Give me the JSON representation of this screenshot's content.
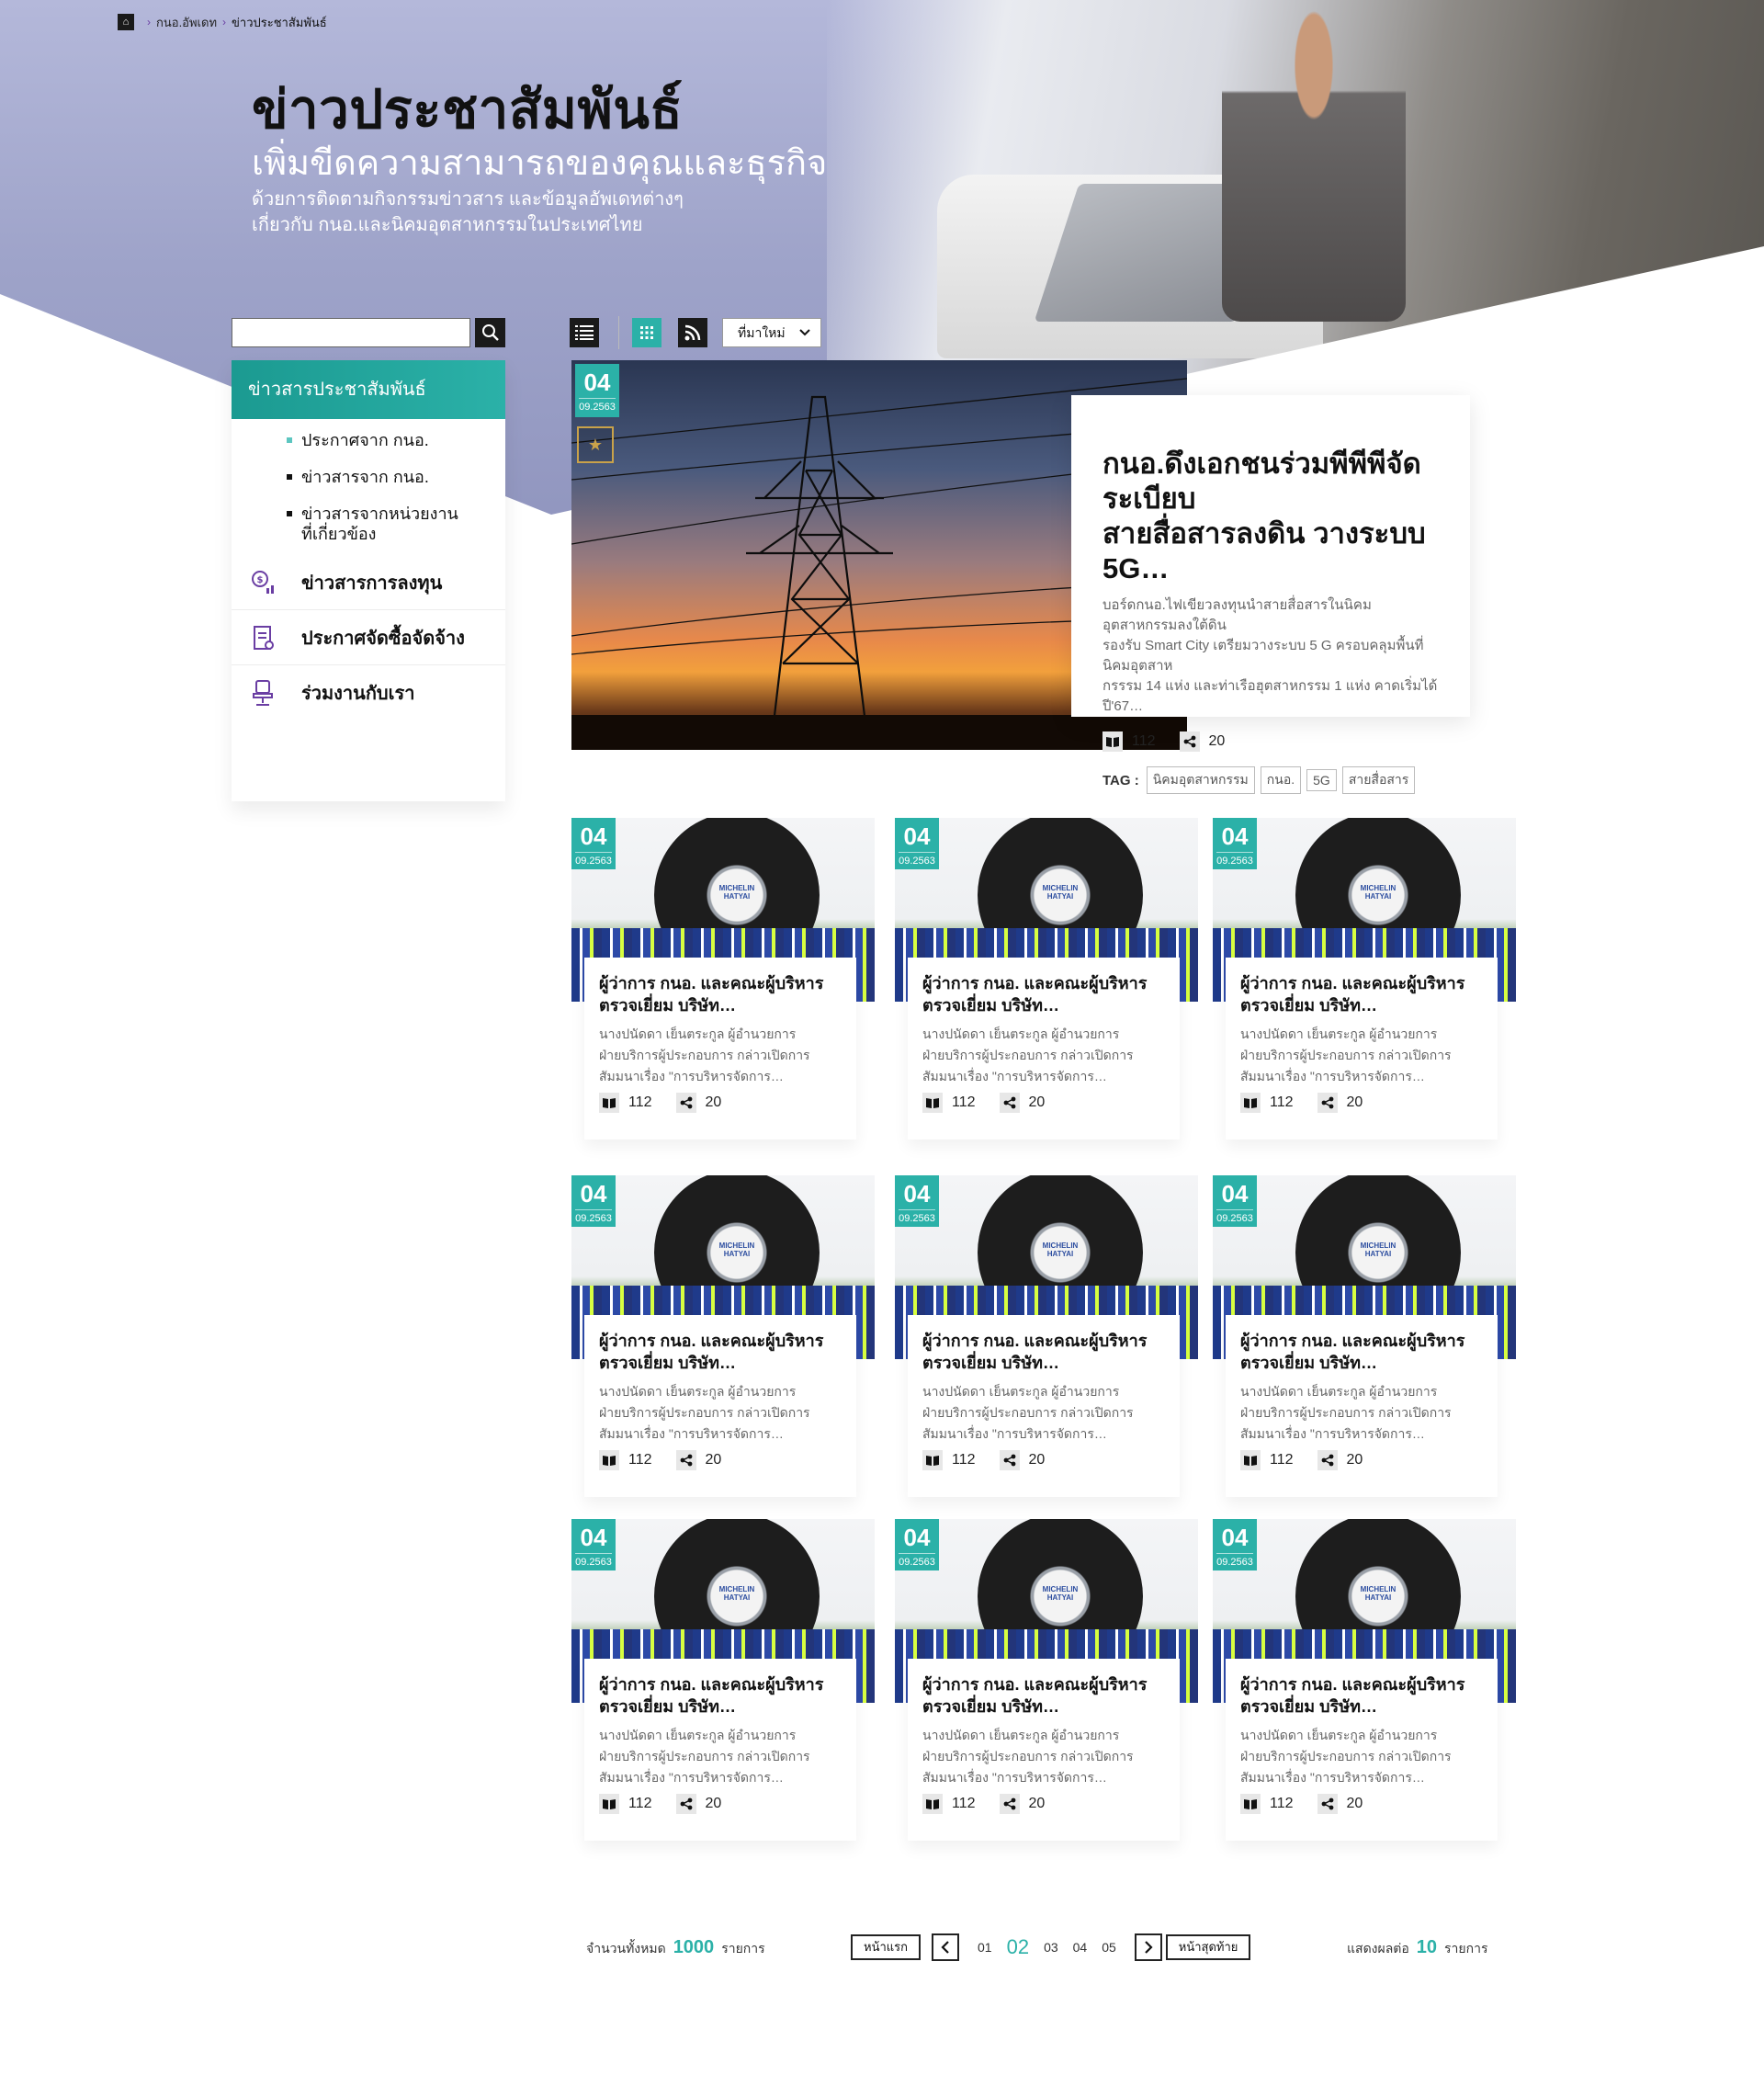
{
  "breadcrumb": {
    "home_icon": "home-icon",
    "items": [
      "กนอ.อัพเดท",
      "ข่าวประชาสัมพันธ์"
    ]
  },
  "hero": {
    "title": "ข่าวประชาสัมพันธ์",
    "subtitle": "เพิ่มขีดความสามารถของคุณและธุรกิจ",
    "desc_line1": "ด้วยการติดตามกิจกรรมข่าวสาร และข้อมูลอัพเดทต่างๆ",
    "desc_line2": "เกี่ยวกับ กนอ.และนิคมอุตสาหกรรมในประเทศไทย"
  },
  "search": {
    "value": "",
    "placeholder": ""
  },
  "sidebar": {
    "header": "ข่าวสารประชาสัมพันธ์",
    "sub_items": [
      {
        "label": "ประกาศจาก กนอ.",
        "active": true
      },
      {
        "label": "ข่าวสารจาก กนอ.",
        "active": false
      },
      {
        "label": "ข่าวสารจากหน่วยงาน",
        "label2": "ที่เกี่ยวข้อง",
        "active": false
      }
    ],
    "main_items": [
      {
        "label": "ข่าวสารการลงทุน",
        "icon": "investment-icon"
      },
      {
        "label": "ประกาศจัดซื้อจัดจ้าง",
        "icon": "procurement-icon"
      },
      {
        "label": "ร่วมงานกับเรา",
        "icon": "office-chair-icon"
      }
    ]
  },
  "toolbar": {
    "sort_value": "ที่มาใหม่",
    "active_view": "grid"
  },
  "featured": {
    "day": "04",
    "month": "09.2563",
    "title_line1": "กนอ.ดึงเอกชนร่วมพีพีพีจัดระเบียบ",
    "title_line2": "สายสื่อสารลงดิน วางระบบ 5G…",
    "excerpt_line1": "บอร์ดกนอ.ไฟเขียวลงทุนนำสายสื่อสารในนิคมอุตสาหกรรมลงใต้ดิน",
    "excerpt_line2": "รองรับ Smart City เตรียมวางระบบ 5 G ครอบคลุมพื้นที่นิคมอุตสาห",
    "excerpt_line3": "กรรรม 14 แห่ง และท่าเรือฮุตสาหกรรม 1 แห่ง คาดเริ่มได้ปี'67…",
    "views": "112",
    "shares": "20",
    "tag_label": "TAG :",
    "tags": [
      "นิคมอุตสาหกรรม",
      "กนอ.",
      "5G",
      "สายสื่อสาร"
    ]
  },
  "cards": [
    {
      "day": "04",
      "month": "09.2563",
      "title_line1": "ผู้ว่าการ กนอ. และคณะผู้บริหาร",
      "title_line2": "ตรวจเยี่ยม บริษัท…",
      "excerpt_line1": "นางปนัดดา เย็นตระกูล ผู้อำนวยการ",
      "excerpt_line2": "ฝ่ายบริการผู้ประกอบการ กล่าวเปิดการ",
      "excerpt_line3": "สัมมนาเรื่อง \"การบริหารจัดการ…",
      "views": "112",
      "shares": "20",
      "brand": "MICHELIN HATYAI"
    },
    {
      "day": "04",
      "month": "09.2563",
      "title_line1": "ผู้ว่าการ กนอ. และคณะผู้บริหาร",
      "title_line2": "ตรวจเยี่ยม บริษัท…",
      "excerpt_line1": "นางปนัดดา เย็นตระกูล ผู้อำนวยการ",
      "excerpt_line2": "ฝ่ายบริการผู้ประกอบการ กล่าวเปิดการ",
      "excerpt_line3": "สัมมนาเรื่อง \"การบริหารจัดการ…",
      "views": "112",
      "shares": "20",
      "brand": "MICHELIN HATYAI"
    },
    {
      "day": "04",
      "month": "09.2563",
      "title_line1": "ผู้ว่าการ กนอ. และคณะผู้บริหาร",
      "title_line2": "ตรวจเยี่ยม บริษัท…",
      "excerpt_line1": "นางปนัดดา เย็นตระกูล ผู้อำนวยการ",
      "excerpt_line2": "ฝ่ายบริการผู้ประกอบการ กล่าวเปิดการ",
      "excerpt_line3": "สัมมนาเรื่อง \"การบริหารจัดการ…",
      "views": "112",
      "shares": "20",
      "brand": "MICHELIN HATYAI"
    },
    {
      "day": "04",
      "month": "09.2563",
      "title_line1": "ผู้ว่าการ กนอ. และคณะผู้บริหาร",
      "title_line2": "ตรวจเยี่ยม บริษัท…",
      "excerpt_line1": "นางปนัดดา เย็นตระกูล ผู้อำนวยการ",
      "excerpt_line2": "ฝ่ายบริการผู้ประกอบการ กล่าวเปิดการ",
      "excerpt_line3": "สัมมนาเรื่อง \"การบริหารจัดการ…",
      "views": "112",
      "shares": "20",
      "brand": "MICHELIN HATYAI"
    },
    {
      "day": "04",
      "month": "09.2563",
      "title_line1": "ผู้ว่าการ กนอ. และคณะผู้บริหาร",
      "title_line2": "ตรวจเยี่ยม บริษัท…",
      "excerpt_line1": "นางปนัดดา เย็นตระกูล ผู้อำนวยการ",
      "excerpt_line2": "ฝ่ายบริการผู้ประกอบการ กล่าวเปิดการ",
      "excerpt_line3": "สัมมนาเรื่อง \"การบริหารจัดการ…",
      "views": "112",
      "shares": "20",
      "brand": "MICHELIN HATYAI"
    },
    {
      "day": "04",
      "month": "09.2563",
      "title_line1": "ผู้ว่าการ กนอ. และคณะผู้บริหาร",
      "title_line2": "ตรวจเยี่ยม บริษัท…",
      "excerpt_line1": "นางปนัดดา เย็นตระกูล ผู้อำนวยการ",
      "excerpt_line2": "ฝ่ายบริการผู้ประกอบการ กล่าวเปิดการ",
      "excerpt_line3": "สัมมนาเรื่อง \"การบริหารจัดการ…",
      "views": "112",
      "shares": "20",
      "brand": "MICHELIN HATYAI"
    },
    {
      "day": "04",
      "month": "09.2563",
      "title_line1": "ผู้ว่าการ กนอ. และคณะผู้บริหาร",
      "title_line2": "ตรวจเยี่ยม บริษัท…",
      "excerpt_line1": "นางปนัดดา เย็นตระกูล ผู้อำนวยการ",
      "excerpt_line2": "ฝ่ายบริการผู้ประกอบการ กล่าวเปิดการ",
      "excerpt_line3": "สัมมนาเรื่อง \"การบริหารจัดการ…",
      "views": "112",
      "shares": "20",
      "brand": "MICHELIN HATYAI"
    },
    {
      "day": "04",
      "month": "09.2563",
      "title_line1": "ผู้ว่าการ กนอ. และคณะผู้บริหาร",
      "title_line2": "ตรวจเยี่ยม บริษัท…",
      "excerpt_line1": "นางปนัดดา เย็นตระกูล ผู้อำนวยการ",
      "excerpt_line2": "ฝ่ายบริการผู้ประกอบการ กล่าวเปิดการ",
      "excerpt_line3": "สัมมนาเรื่อง \"การบริหารจัดการ…",
      "views": "112",
      "shares": "20",
      "brand": "MICHELIN HATYAI"
    },
    {
      "day": "04",
      "month": "09.2563",
      "title_line1": "ผู้ว่าการ กนอ. และคณะผู้บริหาร",
      "title_line2": "ตรวจเยี่ยม บริษัท…",
      "excerpt_line1": "นางปนัดดา เย็นตระกูล ผู้อำนวยการ",
      "excerpt_line2": "ฝ่ายบริการผู้ประกอบการ กล่าวเปิดการ",
      "excerpt_line3": "สัมมนาเรื่อง \"การบริหารจัดการ…",
      "views": "112",
      "shares": "20",
      "brand": "MICHELIN HATYAI"
    }
  ],
  "pagination": {
    "total_prefix": "จำนวนทั้งหมด",
    "total": "1000",
    "total_suffix": "รายการ",
    "first_label": "หน้าแรก",
    "last_label": "หน้าสุดท้าย",
    "pages": [
      "01",
      "02",
      "03",
      "04",
      "05"
    ],
    "current": "02",
    "perpage_prefix": "แสดงผลต่อ",
    "perpage": "10",
    "perpage_suffix": "รายการ"
  },
  "colors": {
    "accent": "#2bb1a8",
    "dark": "#1a1a1a",
    "hero": "#a4a8cf"
  }
}
